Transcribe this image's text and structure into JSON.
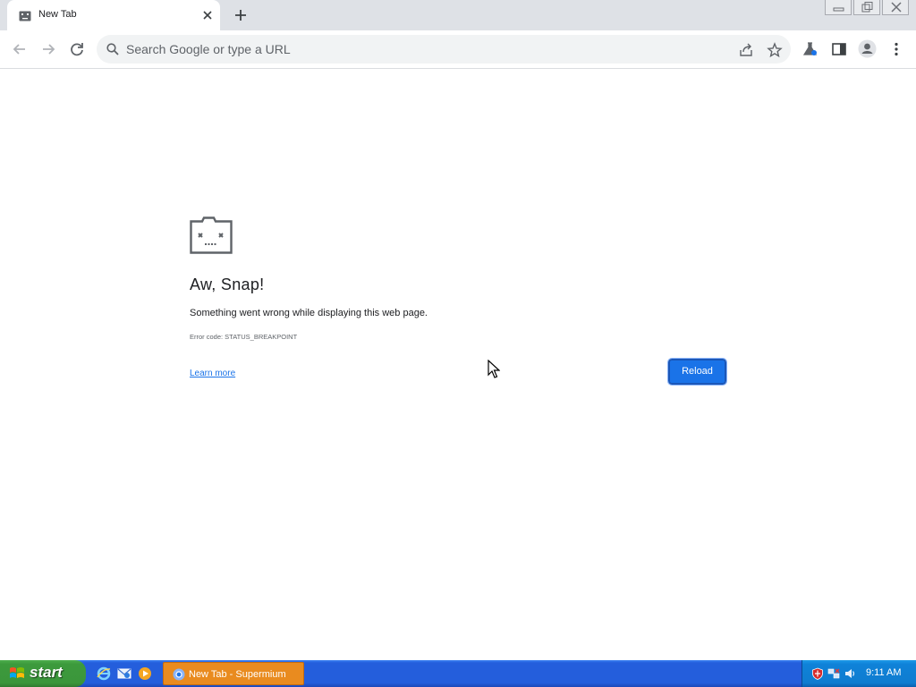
{
  "colors": {
    "accent": "#1a73e8",
    "taskbar": "#245edc",
    "start_green": "#3c9a3c",
    "task_active": "#e98b1f"
  },
  "browser": {
    "tab": {
      "title": "New Tab",
      "favicon": "sad-face-icon",
      "close_icon": "close-icon"
    },
    "new_tab_icon": "plus-icon",
    "window_controls": [
      "minimize-icon",
      "restore-icon",
      "close-icon"
    ],
    "toolbar": {
      "back_icon": "back-arrow-icon",
      "forward_icon": "forward-arrow-icon",
      "reload_icon": "reload-icon",
      "omnibox_placeholder": "Search Google or type a URL",
      "share_icon": "share-icon",
      "bookmark_icon": "star-icon",
      "right_icons": [
        "labs-flask-icon",
        "side-panel-icon",
        "profile-avatar-icon",
        "menu-dots-icon"
      ]
    }
  },
  "error_page": {
    "icon": "sad-tab-icon",
    "heading": "Aw, Snap!",
    "message": "Something went wrong while displaying this web page.",
    "error_code": "Error code: STATUS_BREAKPOINT",
    "learn_more": "Learn more",
    "reload_button": "Reload"
  },
  "taskbar": {
    "start_label": "start",
    "quick_launch": [
      "internet-explorer-icon",
      "outlook-express-icon",
      "media-player-icon"
    ],
    "tasks": [
      {
        "label": "New Tab - Supermium",
        "icon": "chromium-icon"
      }
    ],
    "tray_icons": [
      "security-shield-icon",
      "network-icon",
      "volume-icon"
    ],
    "clock": "9:11 AM"
  }
}
